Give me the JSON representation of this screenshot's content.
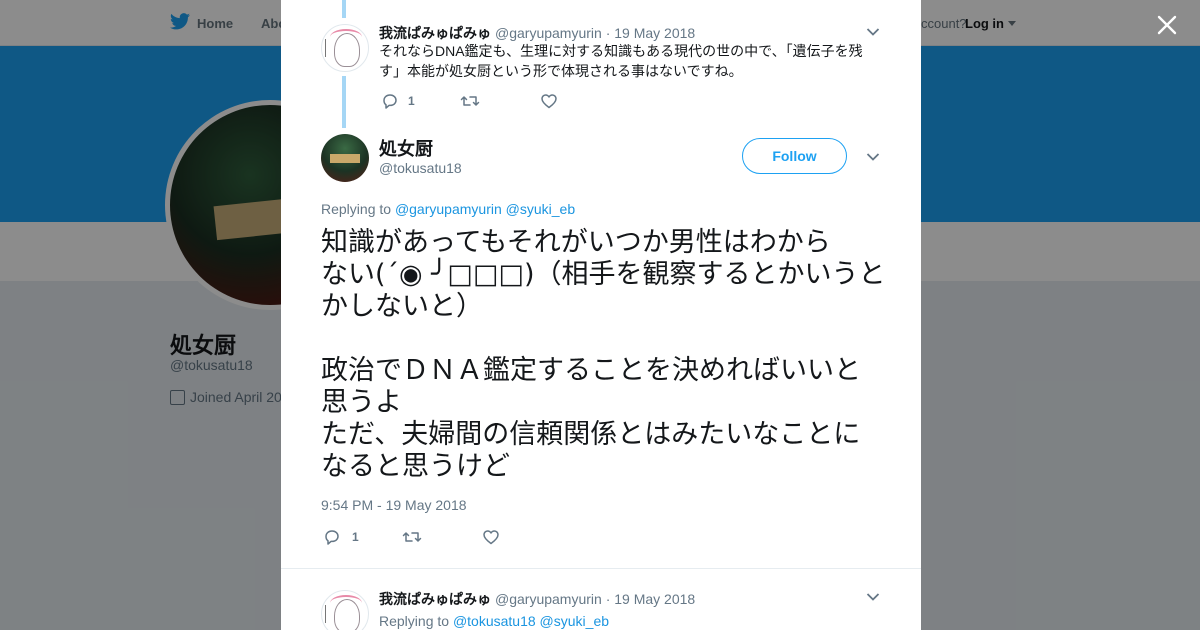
{
  "topbar": {
    "home_label": "Home",
    "about_label": "Abo",
    "account_prompt": "ccount?",
    "login_label": "Log in"
  },
  "profile": {
    "name": "処女厨",
    "handle": "@tokusatu18",
    "joined": "Joined April 20"
  },
  "thread": {
    "prev_tweet": {
      "author_name": "我流ぱみゅぱみゅ",
      "author_handle": "@garyupamyurin",
      "date": "· 19 May 2018",
      "text_line1": "それならDNA鑑定も、生理に対する知識もある現代の世の中で、「遺伝子を残",
      "text_line2": "す」本能が処女厨という形で体現される事はないですね。",
      "reply_count": "1",
      "retweet_count": "",
      "like_count": ""
    },
    "main_tweet": {
      "author_name": "処女厨",
      "author_handle": "@tokusatu18",
      "follow_label": "Follow",
      "replying_prefix": "Replying to",
      "replying_to_1": "@garyupamyurin",
      "replying_to_2": "@syuki_eb",
      "text": "知識があってもそれがいつか男性はわから\nない(´◉ ╯□□□)（相手を観察するとかいうと\nかしないと）\n\n政治でＤＮＡ鑑定することを決めればいいと\n思うよ\nただ、夫婦間の信頼関係とはみたいなことに\nなると思うけど",
      "timestamp": "9:54 PM - 19 May 2018",
      "reply_count": "1",
      "retweet_count": "",
      "like_count": ""
    },
    "next_tweet": {
      "author_name": "我流ぱみゅぱみゅ",
      "author_handle": "@garyupamyurin",
      "date": "· 19 May 2018",
      "replying_prefix": "Replying to",
      "replying_to_1": "@tokusatu18",
      "replying_to_2": "@syuki_eb"
    }
  },
  "icons": {
    "bird": "twitter-bird-icon",
    "close": "close-icon",
    "reply": "reply-icon",
    "retweet": "retweet-icon",
    "like": "heart-icon",
    "more": "chevron-down-icon",
    "calendar": "calendar-icon"
  },
  "colors": {
    "brand_blue": "#1da1f2",
    "link_blue": "#1b95e0",
    "thread_line": "#a5d6f5",
    "muted_text": "#657786"
  }
}
